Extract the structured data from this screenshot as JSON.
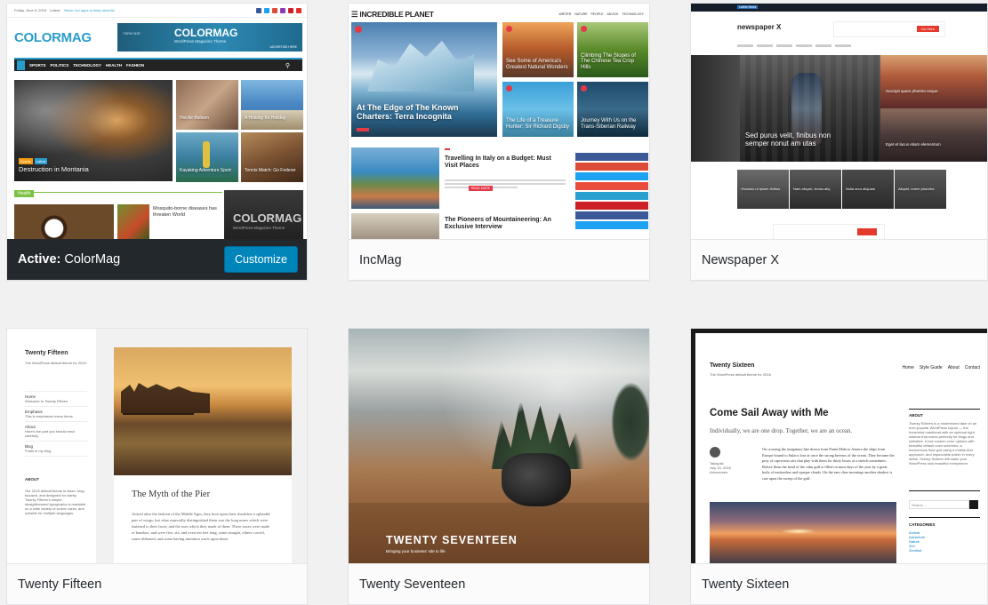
{
  "themes": [
    {
      "name": "ColorMag",
      "active_prefix": "Active:",
      "customize_label": "Customize",
      "preview": {
        "topbar_date": "Friday, June 5, 2015",
        "topbar_latest": "Latest:",
        "topbar_link": "Never run apps to keep secrets!",
        "logo": "COLORMAG",
        "banner_logo": "COLORMAG",
        "banner_sub": "WordPress Magazine Theme",
        "banner_ad": "ADVERTISE HERE",
        "banner_left": "728*90 SIZE",
        "nav": [
          "SPORTS",
          "POLITICS",
          "TECHNOLOGY",
          "HEALTH",
          "FASHION"
        ],
        "hero_tags": [
          "Sports",
          "Latest"
        ],
        "hero_title": "Destruction in Montania",
        "tiles": [
          "Hot Air Balloon",
          "A Holiday for Holiday",
          "Kayaking Adventure Sport",
          "Tennis Match: Go Federer"
        ],
        "section": "Health",
        "post_title": "Mosquito-borne diseases has threaten World",
        "side_logo": "COLORMAG",
        "side_sub": "WordPress Magazine Theme"
      }
    },
    {
      "name": "IncMag",
      "preview": {
        "logo": "INCREDIBLE PLANET",
        "nav": [
          "WRITER",
          "NATURE",
          "PEOPLE",
          "ADVICE",
          "TECHNOLOGY"
        ],
        "hero_title": "At The Edge of The Known Charters: Terra Incognita",
        "tiles": [
          "See Some of America's Greatest Natural Wonders",
          "Climbing The Slopes of The Chinese Tea Crop Hills",
          "The Life of a Treasure Hunter: Sir Richard Digsby",
          "Journey With Us on the Trans-Siberian Railway"
        ],
        "post1_title": "Travelling In Italy on a Budget: Must Visit Places",
        "post2_title": "The Pioneers of Mountaineering: An Exclusive Interview",
        "read_more": "READ MORE",
        "social_colors": [
          "#3b5998",
          "#dd4b39",
          "#1da1f2",
          "#e84c3d",
          "#2aa0d0",
          "#cb2027",
          "#3b5998",
          "#1da1f2"
        ]
      }
    },
    {
      "name": "Newspaper X",
      "preview": {
        "logo": "newspaper X",
        "topbar_badge": "Latest News",
        "hero_title": "Sed purus velit, finibus non semper nonut am utas",
        "tile_right_top": "Suscipit quam phareta neque",
        "tile_right_bottom": "Eget et lacus etiam elementum",
        "strip": [
          "Vivamus ut ipsum finibus",
          "Nam aliquet, lectus aliq",
          "Nulla arcu aliquam",
          "Aliquet, lorem pharetra"
        ],
        "subscribe": "Go Here"
      }
    },
    {
      "name": "Twenty Fifteen",
      "preview": {
        "site_title": "Twenty Fifteen",
        "site_desc": "The WordPress default theme for 2015.",
        "menu": [
          {
            "label": "Home",
            "sub": "Welcome to Twenty Fifteen"
          },
          {
            "label": "Emphasis",
            "sub": "This is emphasize menu items"
          },
          {
            "label": "About",
            "sub": "Here's the part you should read carefully"
          },
          {
            "label": "Blog",
            "sub": "Posts in my blog"
          }
        ],
        "about_heading": "ABOUT",
        "about_text": "Our 2015 default theme is clean, blog-focused, and designed for clarity. Twenty Fifteen's simple, straightforward typography is readable on a wide variety of screen sizes, and suitable for multiple languages.",
        "post_title": "The Myth of the Pier",
        "post_text": "Attired after the fashion of the Middle Ages, they bore upon their shoulders a splendid pair of wings; but what especially distinguished them was the long noses which were fastened to their faces, and the uses which they made of them. These noses were made of bamboo, and were five, six, and even ten feet long, some straight, others curved, some ribboned, and some having imitation warts upon them."
      }
    },
    {
      "name": "Twenty Seventeen",
      "preview": {
        "site_title": "TWENTY SEVENTEEN",
        "tagline": "Bringing your business' site to life"
      }
    },
    {
      "name": "Twenty Sixteen",
      "preview": {
        "site_title": "Twenty Sixteen",
        "site_desc": "The WordPress default theme for 2016",
        "nav": [
          "Home",
          "Style Guide",
          "About",
          "Contact"
        ],
        "post_title": "Come Sail Away with Me",
        "post_lead": "Individually, we are one drop. Together, we are an ocean.",
        "author": "Takayuki",
        "date": "July 15, 2016",
        "category": "Adventures",
        "post_text": "On crossing the imaginary line drawn from Punta Mala to Azuera the ships from Europe bound to Sulaco lose at once the strong breezes of the ocean. They become the prey of capricious airs that play with them for thirty hours at a stretch sometimes. Before them the head of the calm gulf is filled on most days of the year by a great body of motionless and opaque clouds. On the rare clear mornings another shadow is cast upon the sweep of the gulf.",
        "about_heading": "ABOUT",
        "about_text": "Twenty Sixteen is a modernized take on an ever-popular WordPress layout — the horizontal masthead with an optional right sidebar that works perfectly for blogs and websites. It has custom color options with beautiful default color schemes, a harmonious fluid grid using a mobile-first approach, and impeccable polish in every detail. Twenty Sixteen will make your WordPress look beautiful everywhere.",
        "search_placeholder": "Search ...",
        "categories_heading": "CATEGORIES",
        "categories": [
          "Animal",
          "Adventure",
          "Nature",
          "Zen",
          "Zenithal"
        ]
      }
    }
  ]
}
